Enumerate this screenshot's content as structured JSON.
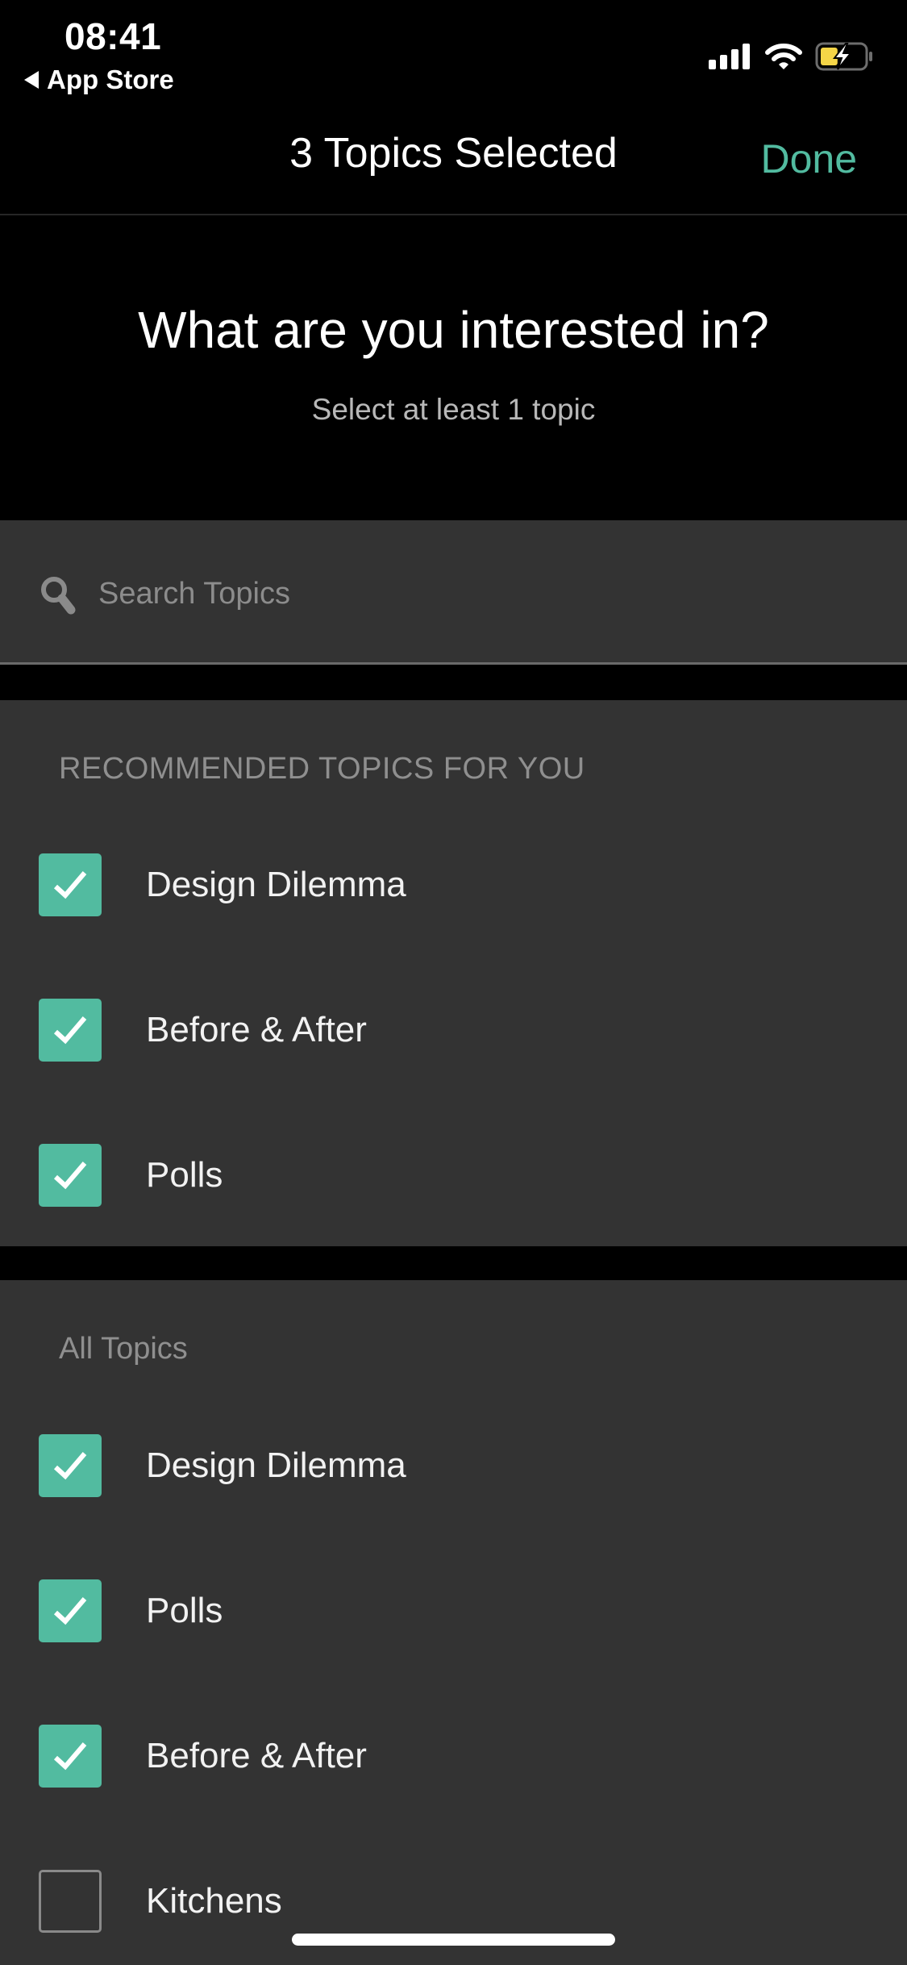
{
  "status_bar": {
    "time": "08:41",
    "back_label": "App Store",
    "battery_level": 0.4,
    "battery_charging": true,
    "icons": [
      "signal-icon",
      "wifi-icon",
      "battery-charging-icon"
    ]
  },
  "nav": {
    "title": "3 Topics Selected",
    "done_label": "Done"
  },
  "intro": {
    "heading": "What are you interested in?",
    "subheading": "Select at least 1 topic"
  },
  "search": {
    "placeholder": "Search Topics",
    "value": ""
  },
  "recommended": {
    "header": "RECOMMENDED TOPICS FOR YOU",
    "items": [
      {
        "label": "Design Dilemma",
        "checked": true
      },
      {
        "label": "Before & After",
        "checked": true
      },
      {
        "label": "Polls",
        "checked": true
      }
    ]
  },
  "all_topics": {
    "header": "All Topics",
    "items": [
      {
        "label": "Design Dilemma",
        "checked": true
      },
      {
        "label": "Polls",
        "checked": true
      },
      {
        "label": "Before & After",
        "checked": true
      },
      {
        "label": "Kitchens",
        "checked": false
      }
    ]
  },
  "colors": {
    "accent": "#52BBA0",
    "background": "#000000",
    "panel": "#333333",
    "battery_fill": "#F5D547"
  }
}
